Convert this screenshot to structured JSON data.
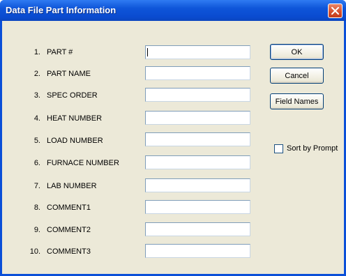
{
  "window": {
    "title": "Data File Part Information",
    "close_icon": "close-icon"
  },
  "fields": [
    {
      "number": "1.",
      "label": "PART #",
      "value": ""
    },
    {
      "number": "2.",
      "label": "PART NAME",
      "value": ""
    },
    {
      "number": "3.",
      "label": "SPEC ORDER",
      "value": ""
    },
    {
      "number": "4.",
      "label": "HEAT NUMBER",
      "value": ""
    },
    {
      "number": "5.",
      "label": "LOAD NUMBER",
      "value": ""
    },
    {
      "number": "6.",
      "label": "FURNACE NUMBER",
      "value": ""
    },
    {
      "number": "7.",
      "label": "LAB NUMBER",
      "value": ""
    },
    {
      "number": "8.",
      "label": "COMMENT1",
      "value": ""
    },
    {
      "number": "9.",
      "label": "COMMENT2",
      "value": ""
    },
    {
      "number": "10.",
      "label": "COMMENT3",
      "value": ""
    }
  ],
  "buttons": {
    "ok": "OK",
    "cancel": "Cancel",
    "field_names": "Field Names"
  },
  "sort_by_prompt": {
    "label": "Sort by Prompt",
    "checked": false
  },
  "colors": {
    "titlebar": "#0a4bd0",
    "dialog_background": "#ece9d8",
    "close_button": "#d6512f"
  }
}
